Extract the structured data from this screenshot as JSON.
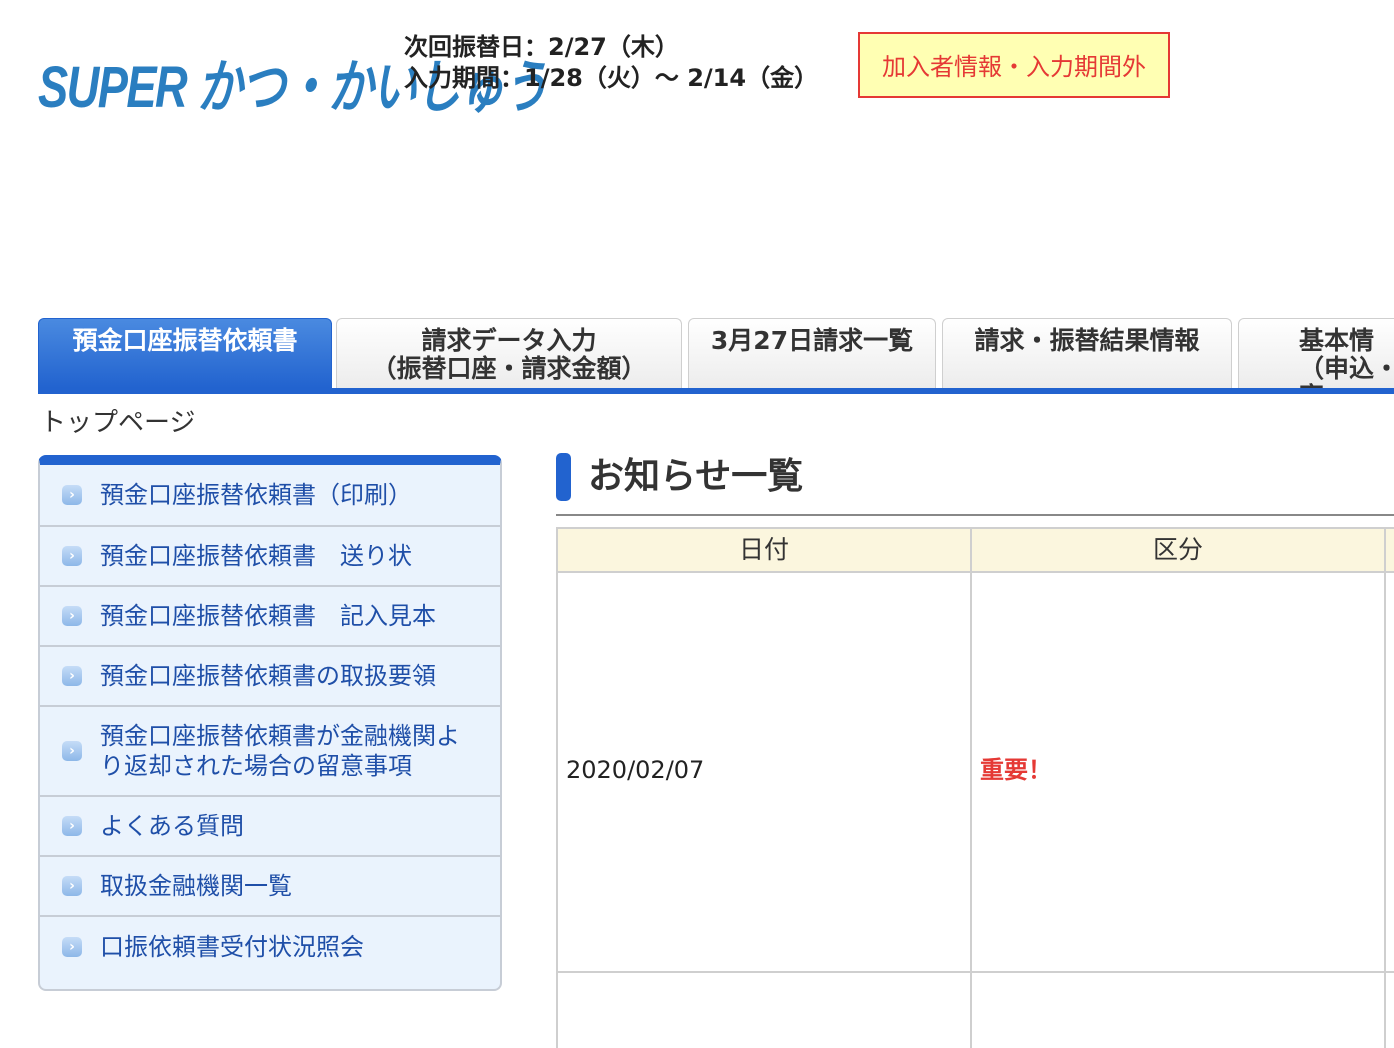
{
  "header": {
    "logo_text": "SUPER かつ・かいしゅう",
    "next_transfer_date": "次回振替日：2/27（木）",
    "input_period": "入力期間：1/28（火）〜 2/14（金）",
    "status_badge": "加入者情報・入力期間外"
  },
  "tabs": [
    {
      "label": "預金口座振替依頼書",
      "active": true
    },
    {
      "label": "請求データ入力\n（振替口座・請求金額）",
      "active": false
    },
    {
      "label": "3月27日請求一覧",
      "active": false
    },
    {
      "label": "請求・振替結果情報",
      "active": false
    },
    {
      "label": "基本情\n（申込・変",
      "active": false
    }
  ],
  "breadcrumb": "トップページ",
  "sidebar": {
    "items": [
      {
        "label": "預金口座振替依頼書（印刷）"
      },
      {
        "label": "預金口座振替依頼書　送り状"
      },
      {
        "label": "預金口座振替依頼書　記入見本"
      },
      {
        "label": "預金口座振替依頼書の取扱要領"
      },
      {
        "label": "預金口座振替依頼書が金融機関よ\nり返却された場合の留意事項"
      },
      {
        "label": "よくある質問"
      },
      {
        "label": "取扱金融機関一覧"
      },
      {
        "label": "口振依頼書受付状況照会"
      }
    ]
  },
  "notices": {
    "title": "お知らせ一覧",
    "columns": [
      "日付",
      "区分"
    ],
    "rows": [
      {
        "date": "2020/02/07",
        "category": "重要！"
      }
    ]
  },
  "colors": {
    "accent_blue": "#2263cf",
    "important_red": "#e53935",
    "badge_bg": "#ffffb3"
  }
}
